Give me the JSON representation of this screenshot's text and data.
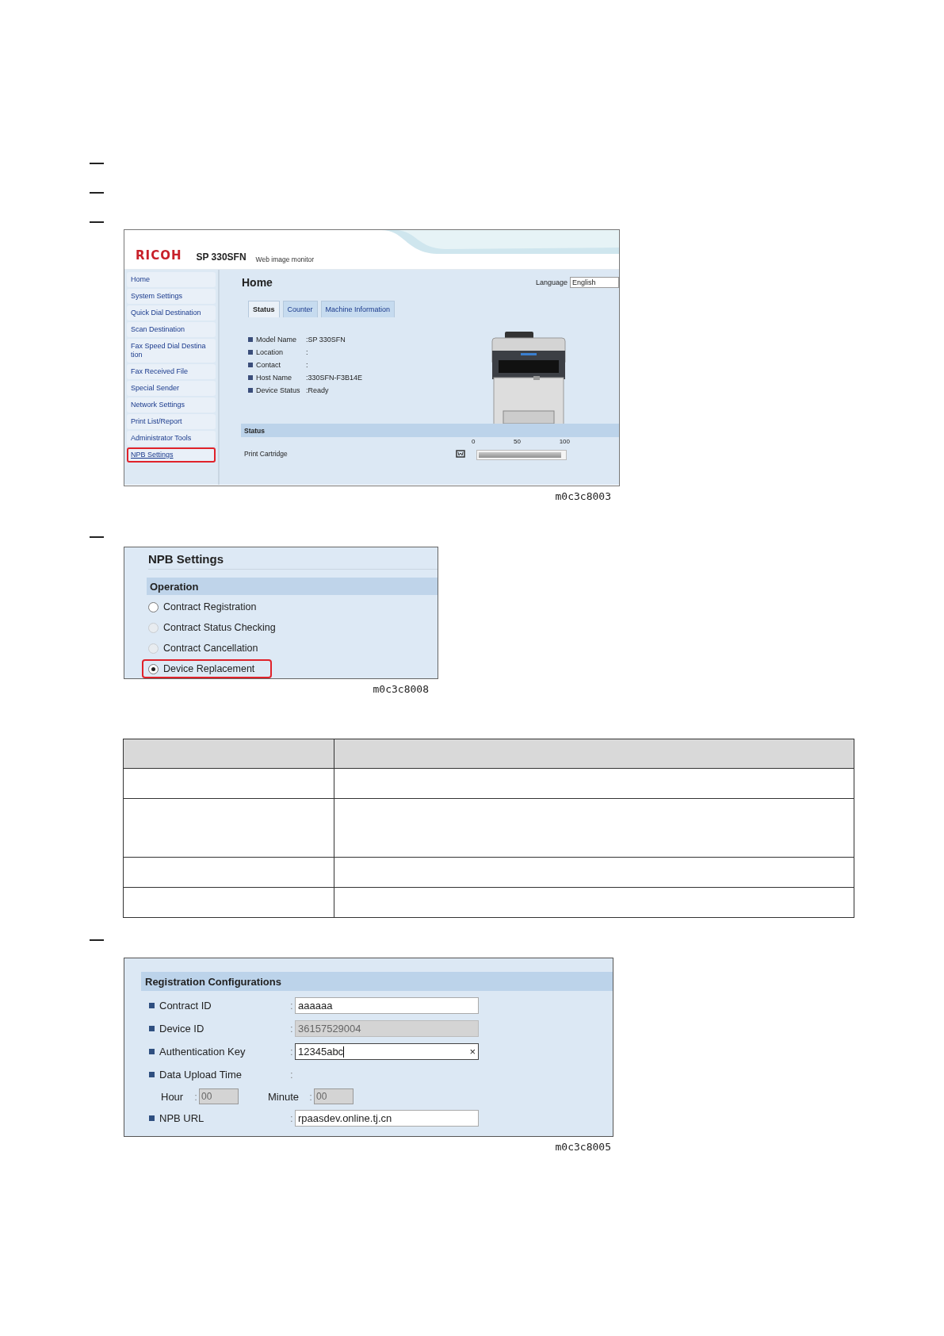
{
  "web_monitor": {
    "logo": "RICOH",
    "model": "SP 330SFN",
    "subtitle": "Web image monitor",
    "sidebar": [
      {
        "label": "Home",
        "underlined": false,
        "highlighted": false
      },
      {
        "label": "System Settings",
        "underlined": false,
        "highlighted": false
      },
      {
        "label": "Quick Dial Destination",
        "underlined": false,
        "highlighted": false
      },
      {
        "label": "Scan Destination",
        "underlined": false,
        "highlighted": false
      },
      {
        "label": "Fax Speed Dial Destina\ntion",
        "underlined": false,
        "highlighted": false
      },
      {
        "label": "Fax Received File",
        "underlined": false,
        "highlighted": false
      },
      {
        "label": "Special Sender",
        "underlined": false,
        "highlighted": false
      },
      {
        "label": "Network Settings",
        "underlined": false,
        "highlighted": false
      },
      {
        "label": "Print List/Report",
        "underlined": false,
        "highlighted": false
      },
      {
        "label": "Administrator Tools",
        "underlined": false,
        "highlighted": false
      },
      {
        "label": "NPB Settings",
        "underlined": true,
        "highlighted": true
      }
    ],
    "page_title": "Home",
    "language_label": "Language",
    "language_value": "English",
    "tabs": [
      {
        "label": "Status",
        "selected": true
      },
      {
        "label": "Counter",
        "selected": false
      },
      {
        "label": "Machine Information",
        "selected": false
      }
    ],
    "info": [
      {
        "label": "Model Name",
        "value": ":SP 330SFN"
      },
      {
        "label": "Location",
        "value": ":"
      },
      {
        "label": "Contact",
        "value": ":"
      },
      {
        "label": "Host Name",
        "value": ":330SFN-F3B14E"
      },
      {
        "label": "Device Status",
        "value": ":Ready"
      }
    ],
    "status_header": "Status",
    "cartridge_label": "Print Cartridge",
    "scale": [
      "0",
      "50",
      "100"
    ],
    "cartridge": {
      "level": 0.96
    },
    "caption": "m0c3c8003"
  },
  "npb_settings": {
    "title": "NPB Settings",
    "section": "Operation",
    "options": [
      {
        "label": "Contract Registration",
        "selected": false,
        "disabled": false,
        "highlighted": false
      },
      {
        "label": "Contract Status Checking",
        "selected": false,
        "disabled": true,
        "highlighted": false
      },
      {
        "label": "Contract Cancellation",
        "selected": false,
        "disabled": true,
        "highlighted": false
      },
      {
        "label": "Device Replacement",
        "selected": true,
        "disabled": false,
        "highlighted": true
      }
    ],
    "caption": "m0c3c8008"
  },
  "registration": {
    "section": "Registration Configurations",
    "rows": [
      {
        "kind": "field",
        "label": "Contract ID",
        "separator": ":",
        "value": "aaaaaa",
        "disabled": false,
        "focused": false
      },
      {
        "kind": "field",
        "label": "Device ID",
        "separator": ":",
        "value": "36157529004",
        "disabled": true,
        "focused": false
      },
      {
        "kind": "field",
        "label": "Authentication Key",
        "separator": ":",
        "value": "12345abc",
        "disabled": false,
        "focused": true,
        "clear": "×"
      },
      {
        "kind": "heading",
        "label": "Data Upload Time",
        "separator": ":"
      },
      {
        "kind": "time",
        "hour_label": "Hour",
        "hour_separator": ":",
        "hour_value": "00",
        "minute_label": "Minute",
        "minute_separator": ":",
        "minute_value": "00",
        "disabled": true
      },
      {
        "kind": "field",
        "label": "NPB URL",
        "separator": ":",
        "value": "rpaasdev.online.tj.cn",
        "disabled": false,
        "focused": false
      }
    ],
    "caption": "m0c3c8005"
  }
}
